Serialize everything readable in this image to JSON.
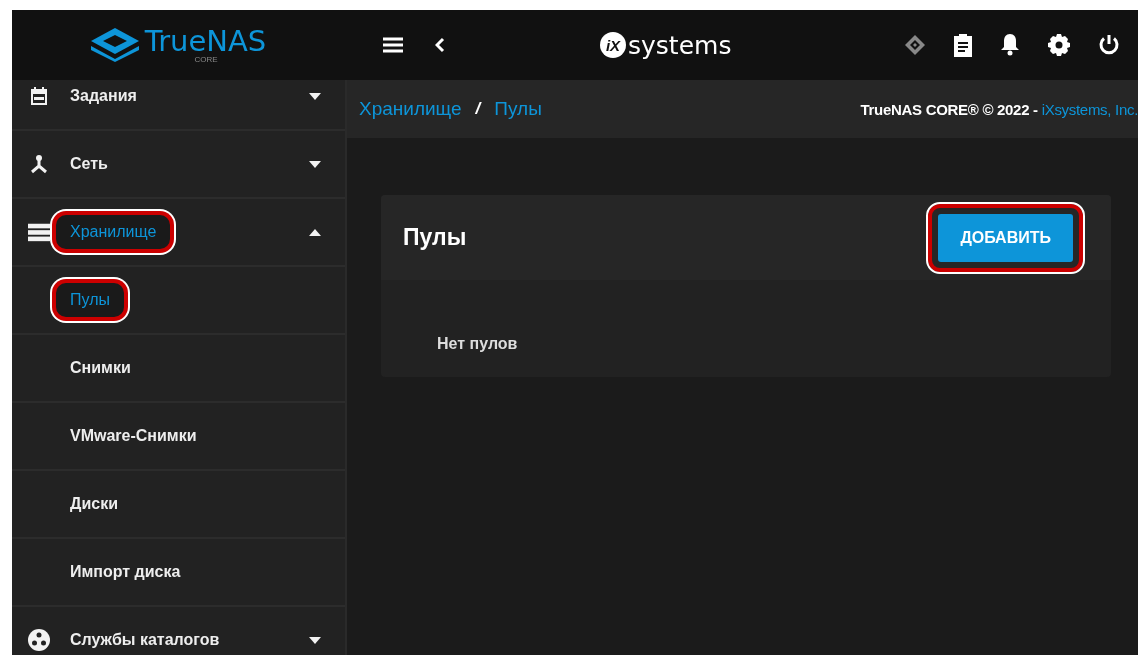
{
  "topbar": {
    "logo": {
      "name": "TrueNAS",
      "edition": "CORE"
    },
    "vendor": {
      "mark": "iX",
      "name": "systems"
    }
  },
  "sidebar": {
    "items": [
      {
        "label": "Задания",
        "expanded": false,
        "selected": false,
        "highlighted": false
      },
      {
        "label": "Сеть",
        "expanded": false,
        "selected": false,
        "highlighted": false
      },
      {
        "label": "Хранилище",
        "expanded": true,
        "selected": true,
        "highlighted": true,
        "children": [
          {
            "label": "Пулы",
            "selected": true,
            "highlighted": true
          },
          {
            "label": "Снимки",
            "selected": false,
            "highlighted": false
          },
          {
            "label": "VMware-Снимки",
            "selected": false,
            "highlighted": false
          },
          {
            "label": "Диски",
            "selected": false,
            "highlighted": false
          },
          {
            "label": "Импорт диска",
            "selected": false,
            "highlighted": false
          }
        ]
      },
      {
        "label": "Службы каталогов",
        "expanded": false,
        "selected": false,
        "highlighted": false
      }
    ]
  },
  "breadcrumb": {
    "items": [
      "Хранилище",
      "Пулы"
    ],
    "separator": "/"
  },
  "copyright": {
    "text": "TrueNAS CORE® © 2022 - ",
    "link": "iXsystems, Inc."
  },
  "card": {
    "title": "Пулы",
    "button": {
      "label": "ДОБАВИТЬ",
      "highlighted": true
    },
    "empty": "Нет пулов"
  }
}
